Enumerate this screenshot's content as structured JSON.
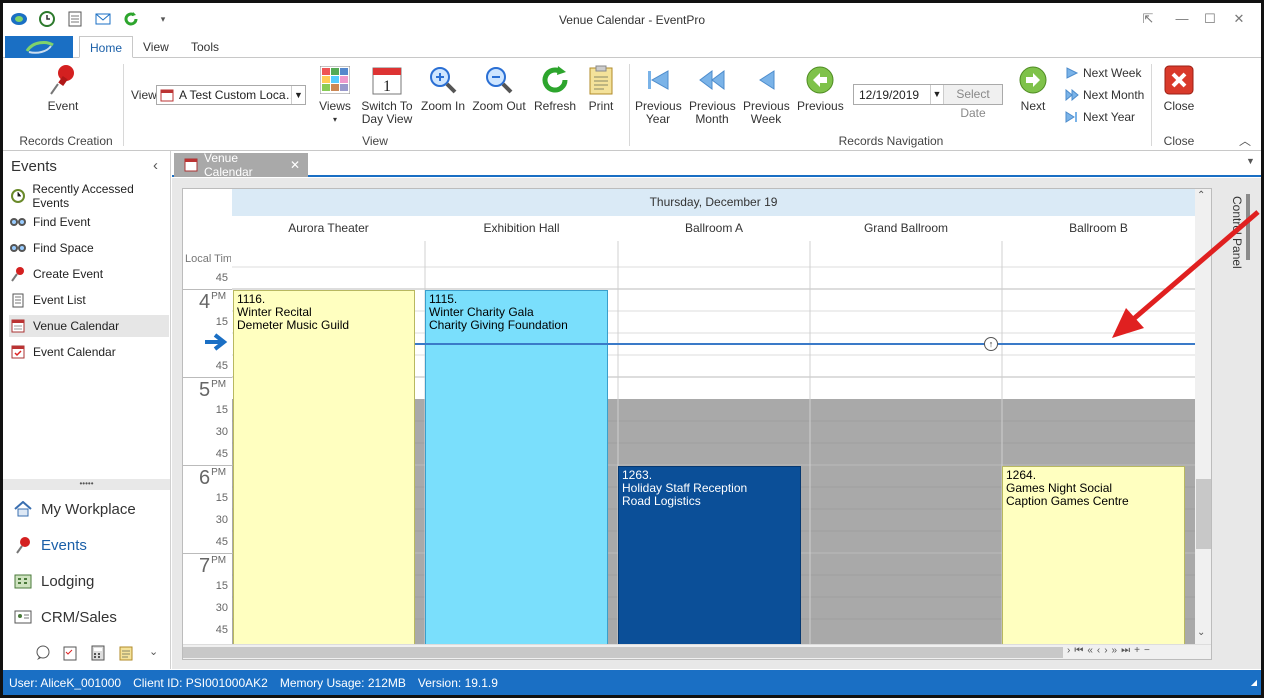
{
  "window": {
    "title": "Venue Calendar - EventPro"
  },
  "ribbon_tabs": [
    "Home",
    "View",
    "Tools"
  ],
  "ribbon": {
    "event_btn": "Event",
    "records_creation": "Records Creation",
    "view_label": "View",
    "view_select": "A Test Custom Loca…",
    "views_btn": "Views",
    "switch_day_btn_1": "Switch To",
    "switch_day_btn_2": "Day View",
    "zoom_in": "Zoom In",
    "zoom_out": "Zoom Out",
    "refresh": "Refresh",
    "print": "Print",
    "view_group": "View",
    "prev_year_1": "Previous",
    "prev_year_2": "Year",
    "prev_month_1": "Previous",
    "prev_month_2": "Month",
    "prev_week_1": "Previous",
    "prev_week_2": "Week",
    "previous": "Previous",
    "date_value": "12/19/2019",
    "select_date": "Select Date",
    "next": "Next",
    "next_week": "Next Week",
    "next_month": "Next Month",
    "next_year": "Next Year",
    "records_navigation": "Records Navigation",
    "close_btn": "Close",
    "close_group": "Close",
    "day_number": "1"
  },
  "left_panel": {
    "title": "Events",
    "items": [
      {
        "label": "Recently Accessed Events"
      },
      {
        "label": "Find Event"
      },
      {
        "label": "Find Space"
      },
      {
        "label": "Create Event"
      },
      {
        "label": "Event List"
      },
      {
        "label": "Venue Calendar"
      },
      {
        "label": "Event Calendar"
      }
    ],
    "workspaces": [
      {
        "label": "My Workplace"
      },
      {
        "label": "Events"
      },
      {
        "label": "Lodging"
      },
      {
        "label": "CRM/Sales"
      }
    ]
  },
  "doc_tab": {
    "label": "Venue Calendar"
  },
  "calendar": {
    "date_header": "Thursday, December 19",
    "resources": [
      "Aurora Theater",
      "Exhibition Hall",
      "Ballroom A",
      "Grand Ballroom",
      "Ballroom B"
    ],
    "local_time_label": "Local Time",
    "time_labels": {
      "m45a": "45",
      "h4": "4",
      "pm4": "PM",
      "m15a": "15",
      "m45b": "45",
      "h5": "5",
      "pm5": "PM",
      "m15b": "15",
      "m30b": "30",
      "m45c": "45",
      "h6": "6",
      "pm6": "PM",
      "m15c": "15",
      "m30c": "30",
      "m45d": "45",
      "h7": "7",
      "pm7": "PM",
      "m15d": "15",
      "m30d": "30",
      "m45e": "45"
    },
    "events": [
      {
        "id": "1116.",
        "title": "Winter Recital",
        "org": "Demeter Music Guild"
      },
      {
        "id": "1115.",
        "title": "Winter Charity Gala",
        "org": "Charity Giving Foundation"
      },
      {
        "id": "1263.",
        "title": "Holiday Staff Reception",
        "org": "Road Logistics"
      },
      {
        "id": "1264.",
        "title": "Games Night Social",
        "org": "Caption Games Centre"
      }
    ],
    "control_panel": "Control Panel"
  },
  "status": {
    "user": "User: AliceK_001000",
    "client": "Client ID: PSI001000AK2",
    "memory": "Memory Usage: 212MB",
    "version": "Version: 19.1.9"
  },
  "colors": {
    "accent": "#1a6fc4",
    "event_yellow": "#ffffc0",
    "event_cyan": "#7adffc",
    "event_navy": "#0b4f98",
    "off_hours": "#a9a9a9",
    "annotation_arrow": "#e02020"
  }
}
